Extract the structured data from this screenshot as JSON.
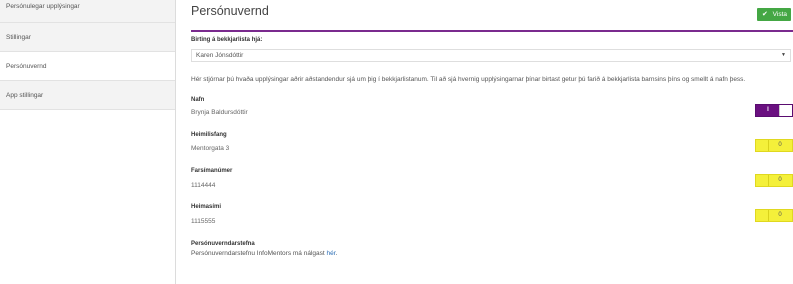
{
  "sidebar": {
    "items": [
      {
        "label": "Persónulegar upplýsingar"
      },
      {
        "label": "Stillingar"
      },
      {
        "label": "Persónuvernd"
      },
      {
        "label": "App stillingar"
      }
    ]
  },
  "header": {
    "title": "Persónuvernd",
    "save_label": "Vista",
    "save_icon": "✔"
  },
  "visibility": {
    "label": "Birting á bekkjarlista hjá:",
    "selected": "Karen Jónsdóttir",
    "caret": "▼"
  },
  "info_text": "Hér stjórnar þú hvaða upplýsingar aðrir aðstandendur sjá um þig í bekkjarlistanum. Til að sjá hvernig upplýsingarnar þínar birtast getur þú farið á bekkjarlista barnsins þíns og smellt á nafn þess.",
  "fields": [
    {
      "label": "Nafn",
      "value": "Brynja Baldursdóttir",
      "toggle_text": "I",
      "state": "on"
    },
    {
      "label": "Heimilisfang",
      "value": "Mentorgata 3",
      "toggle_text": "0",
      "state": "off"
    },
    {
      "label": "Farsímanúmer",
      "value": "1114444",
      "toggle_text": "0",
      "state": "off"
    },
    {
      "label": "Heimasími",
      "value": "1115555",
      "toggle_text": "0",
      "state": "off"
    }
  ],
  "policy": {
    "heading": "Persónuverndarstefna",
    "text": "Persónuverndarstefnu InfoMentors má nálgast ",
    "link": "hér",
    "after": "."
  },
  "colors": {
    "accent": "#7a2a8e",
    "save": "#44a744",
    "toggle_on": "#6a1080",
    "toggle_off": "#f4f03a"
  }
}
